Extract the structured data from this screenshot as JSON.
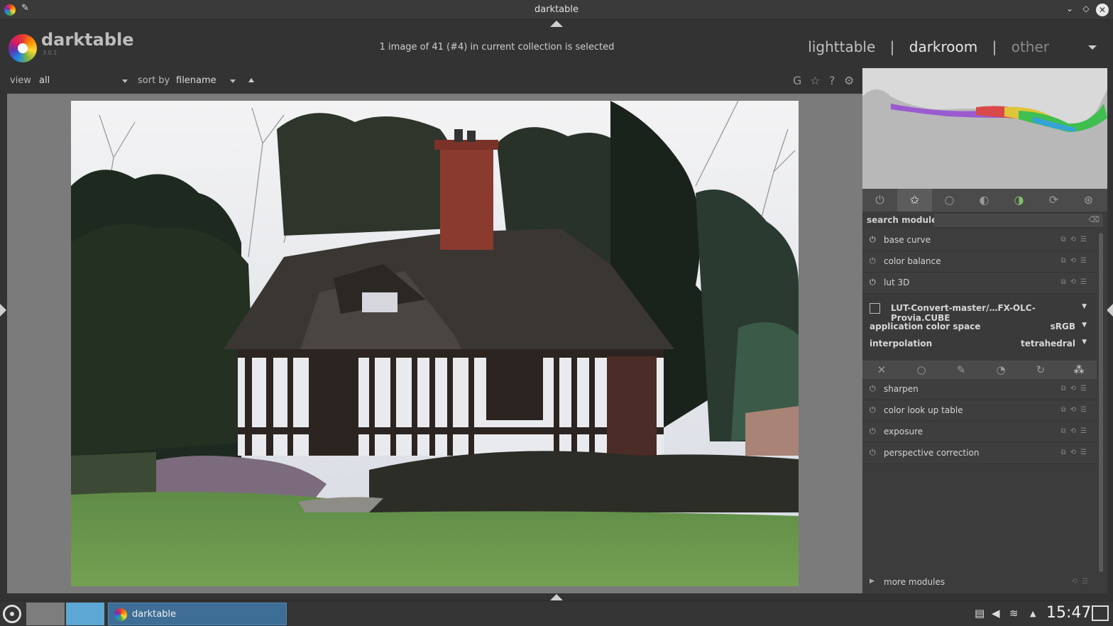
{
  "window": {
    "title": "darktable"
  },
  "header": {
    "logo_text": "darktable",
    "version": "3.0.1",
    "status": "1 image of 41 (#4) in current collection is selected",
    "views": {
      "lighttable": "lighttable",
      "darkroom": "darkroom",
      "other": "other",
      "sep": "|"
    }
  },
  "filterbar": {
    "view_label": "view",
    "view_value": "all",
    "sort_label": "sort by",
    "sort_value": "filename",
    "icons": [
      "G",
      "☆",
      "?",
      "⚙"
    ]
  },
  "right_panel": {
    "group_tabs": [
      "power-icon",
      "star-icon",
      "circle-icon",
      "tone-icon",
      "color-icon",
      "correct-icon",
      "effect-icon"
    ],
    "search_label": "search module",
    "modules_top": [
      {
        "name": "base curve",
        "on": true
      },
      {
        "name": "color balance",
        "on": false
      },
      {
        "name": "lut 3D",
        "on": true
      }
    ],
    "lut3d": {
      "file": "LUT-Convert-master/…FX-OLC-Provia.CUBE",
      "app_color_space_label": "application color space",
      "app_color_space_value": "sRGB",
      "interpolation_label": "interpolation",
      "interpolation_value": "tetrahedral"
    },
    "modules_bottom": [
      {
        "name": "sharpen",
        "on": false
      },
      {
        "name": "color look up table",
        "on": false
      },
      {
        "name": "exposure",
        "on": false
      },
      {
        "name": "perspective correction",
        "on": false
      }
    ],
    "more_modules": "more modules"
  },
  "taskbar": {
    "task_label": "darktable",
    "clock": "15:47"
  }
}
